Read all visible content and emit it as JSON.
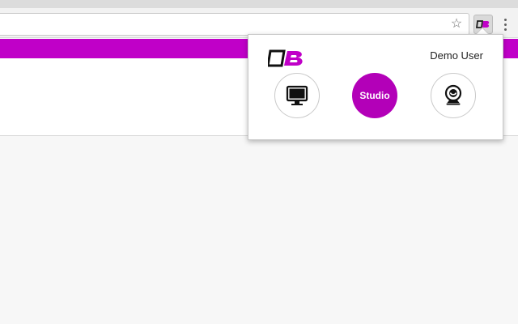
{
  "popup": {
    "user_name": "Demo User",
    "actions": [
      {
        "label": "",
        "icon": "desktop-icon"
      },
      {
        "label": "Studio",
        "icon": ""
      },
      {
        "label": "",
        "icon": "webcam-icon"
      }
    ]
  },
  "icons": {
    "star": "☆",
    "extension": "extension-logo-icon",
    "menu": "menu-dots-icon"
  },
  "colors": {
    "accent": "#c000c8",
    "studio": "#b300b8",
    "chrome": "#f2f2f2"
  }
}
